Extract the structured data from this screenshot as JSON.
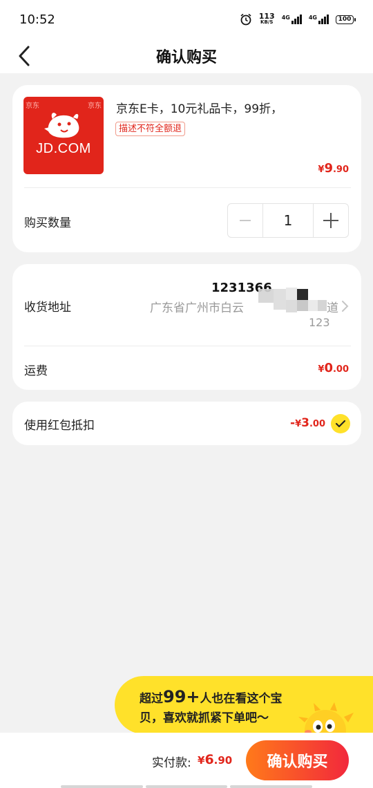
{
  "status_bar": {
    "time": "10:52",
    "net_speed_value": "113",
    "net_speed_unit": "KB/S",
    "signal1_label": "4G",
    "signal2_label": "4G",
    "battery": "100"
  },
  "header": {
    "title": "确认购买",
    "back_icon": "chevron-left-icon"
  },
  "product": {
    "thumbnail_brand_small": "京东",
    "thumbnail_brand": "JD.COM",
    "title": "京东E卡，10元礼品卡，99折，",
    "tag": "描述不符全额退",
    "price_currency": "¥",
    "price_int": "9",
    "price_dec": ".90"
  },
  "quantity": {
    "label": "购买数量",
    "value": "1",
    "minus_icon": "minus-icon",
    "plus_icon": "plus-icon"
  },
  "address": {
    "label": "收货地址",
    "name_phone": "1231366",
    "line": "广东省广州市白云",
    "line_tail": "道",
    "zip": "123"
  },
  "shipping": {
    "label": "运费",
    "currency": "¥",
    "int": "0",
    "dec": ".00"
  },
  "red_packet": {
    "label": "使用红包抵扣",
    "prefix": "-",
    "currency": "¥",
    "int": "3",
    "dec": ".00",
    "checked": true
  },
  "promo_bubble": {
    "line1_a": "超过",
    "line1_big": "99+",
    "line1_b": "人也在看这个宝",
    "line2": "贝，喜欢就抓紧下单吧～"
  },
  "footer": {
    "pay_label": "实付款:",
    "pay_currency": "¥",
    "pay_int": "6",
    "pay_dec": ".90",
    "confirm_label": "确认购买"
  },
  "colors": {
    "accent_red": "#e1251b",
    "yellow": "#ffe12a",
    "button_gradient_start": "#ff7a1a",
    "button_gradient_end": "#f2283c"
  }
}
